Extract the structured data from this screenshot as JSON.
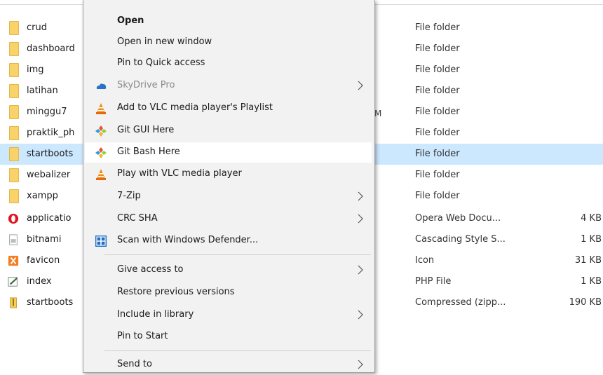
{
  "files": [
    {
      "name": "crud",
      "type": "File folder",
      "size": "",
      "icon": "folder-icon"
    },
    {
      "name": "dashboard",
      "type": "File folder",
      "size": "",
      "icon": "folder-icon"
    },
    {
      "name": "img",
      "type": "File folder",
      "size": "",
      "icon": "folder-icon"
    },
    {
      "name": "latihan",
      "type": "File folder",
      "size": "",
      "icon": "folder-icon"
    },
    {
      "name": "minggu7",
      "type": "File folder",
      "size": "",
      "icon": "folder-icon"
    },
    {
      "name": "praktik_ph",
      "type": "File folder",
      "size": "",
      "icon": "folder-icon"
    },
    {
      "name": "startboots",
      "type": "File folder",
      "size": "",
      "icon": "folder-icon"
    },
    {
      "name": "webalizer",
      "type": "File folder",
      "size": "",
      "icon": "folder-icon"
    },
    {
      "name": "xampp",
      "type": "File folder",
      "size": "",
      "icon": "folder-icon"
    },
    {
      "name": "applicatio",
      "type": "Opera Web Docu...",
      "size": "4 KB",
      "icon": "opera-icon"
    },
    {
      "name": "bitnami",
      "type": "Cascading Style S...",
      "size": "1 KB",
      "icon": "css-file-icon"
    },
    {
      "name": "favicon",
      "type": "Icon",
      "size": "31 KB",
      "icon": "xampp-icon"
    },
    {
      "name": "index",
      "type": "PHP File",
      "size": "1 KB",
      "icon": "php-file-icon"
    },
    {
      "name": "startboots",
      "type": "Compressed (zipp...",
      "size": "190 KB",
      "icon": "zip-icon"
    }
  ],
  "behind_menu_fragment": "M",
  "context_menu": {
    "items": [
      {
        "label": "Open",
        "bold": true,
        "icon": "",
        "submenu": false
      },
      {
        "label": "Open in new window",
        "icon": "",
        "submenu": false
      },
      {
        "label": "Pin to Quick access",
        "icon": "",
        "submenu": false
      },
      {
        "label": "SkyDrive Pro",
        "disabled": true,
        "icon": "skydrive-icon",
        "submenu": true
      },
      {
        "label": "Add to VLC media player's Playlist",
        "icon": "vlc-icon",
        "submenu": false
      },
      {
        "label": "Git GUI Here",
        "icon": "git-icon",
        "submenu": false
      },
      {
        "label": "Git Bash Here",
        "icon": "git-icon",
        "submenu": false,
        "hover": true
      },
      {
        "label": "Play with VLC media player",
        "icon": "vlc-icon",
        "submenu": false
      },
      {
        "label": "7-Zip",
        "icon": "",
        "submenu": true
      },
      {
        "label": "CRC SHA",
        "icon": "",
        "submenu": true
      },
      {
        "label": "Scan with Windows Defender...",
        "icon": "windows-defender-icon",
        "submenu": false
      },
      {
        "label": "Give access to",
        "icon": "",
        "submenu": true
      },
      {
        "label": "Restore previous versions",
        "icon": "",
        "submenu": false
      },
      {
        "label": "Include in library",
        "icon": "",
        "submenu": true
      },
      {
        "label": "Pin to Start",
        "icon": "",
        "submenu": false
      },
      {
        "label": "Send to",
        "icon": "",
        "submenu": true
      }
    ]
  }
}
